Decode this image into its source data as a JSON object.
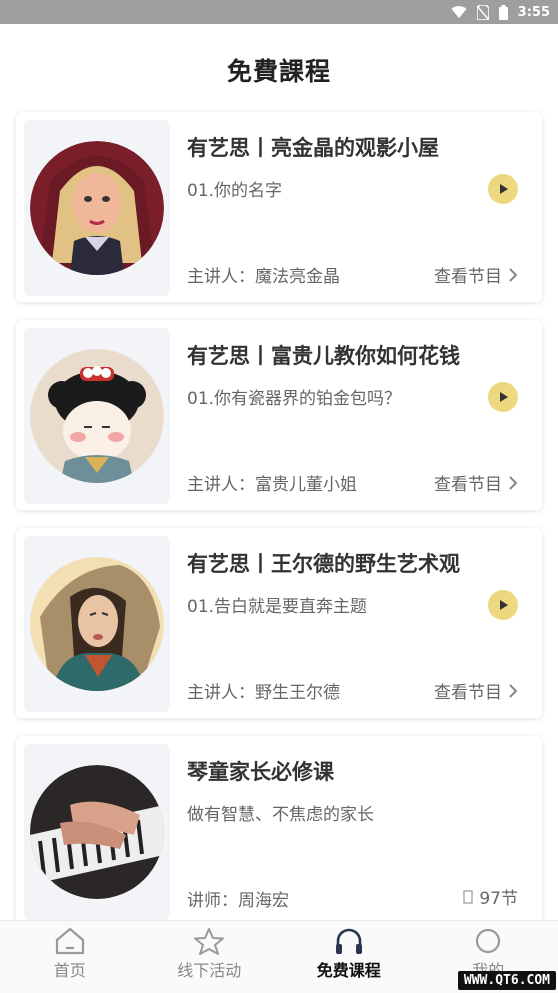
{
  "status_bar": {
    "time": "3:55"
  },
  "page": {
    "title": "免費課程"
  },
  "courses": [
    {
      "title": "有艺思丨亮金晶的观影小屋",
      "episode": "01.你的名字",
      "host": "主讲人：魔法亮金晶",
      "link": "查看节目"
    },
    {
      "title": "有艺思丨富贵儿教你如何花钱",
      "episode": "01.你有瓷器界的铂金包吗？",
      "host": "主讲人：富贵儿董小姐",
      "link": "查看节目"
    },
    {
      "title": "有艺思丨王尔德的野生艺术观",
      "episode": "01.告白就是要直奔主题",
      "host": "主讲人：野生王尔德",
      "link": "查看节目"
    },
    {
      "title": "琴童家长必修课",
      "episode": "做有智慧、不焦虑的家长",
      "host": "讲师：周海宏",
      "count": "97节"
    }
  ],
  "tabs": [
    {
      "label": "首页",
      "icon": "home-icon"
    },
    {
      "label": "线下活动",
      "icon": "star-icon"
    },
    {
      "label": "免费课程",
      "icon": "headphones-icon",
      "active": true
    },
    {
      "label": "我的",
      "icon": "profile-icon"
    }
  ],
  "watermark": "WWW.QT6.COM",
  "colors": {
    "accent": "#ecd87e",
    "status_bar": "#9e9e9e"
  }
}
